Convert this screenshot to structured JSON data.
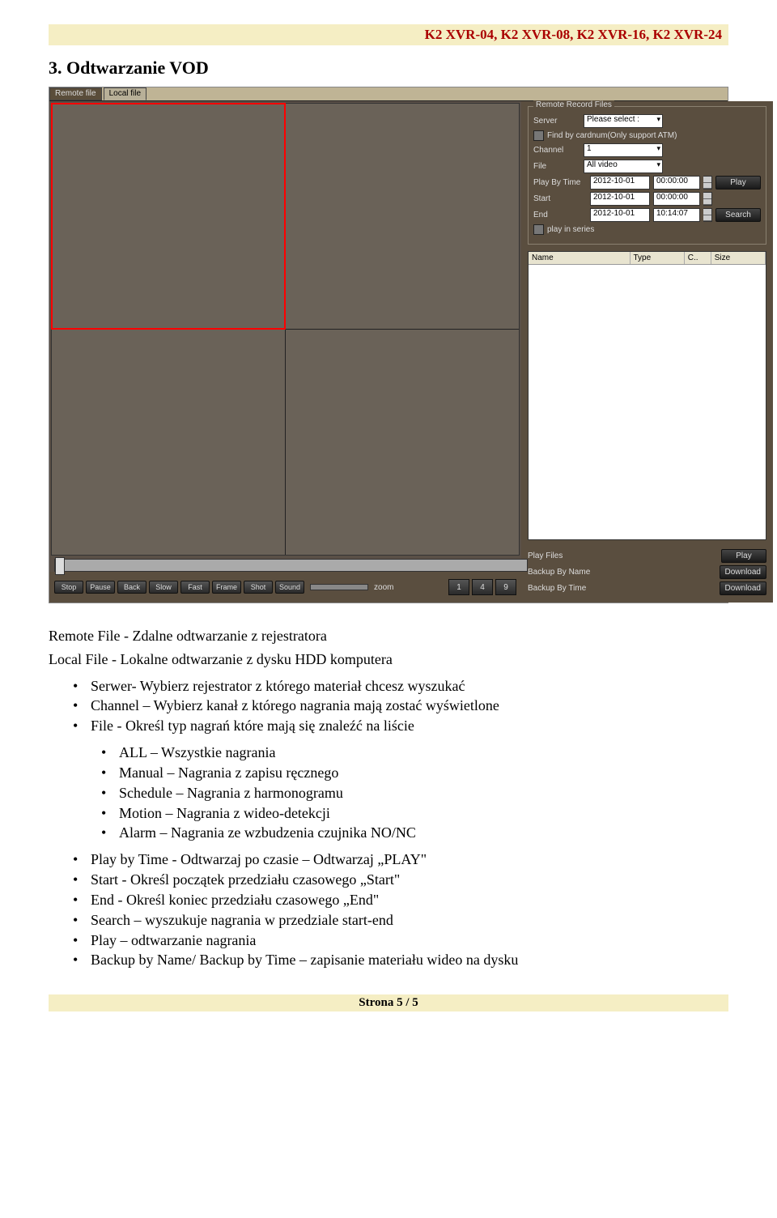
{
  "header": "K2 XVR-04, K2 XVR-08, K2 XVR-16, K2 XVR-24",
  "section_title": "3. Odtwarzanie VOD",
  "app": {
    "tabs": {
      "remote": "Remote file",
      "local": "Local file"
    },
    "remote_panel": {
      "legend": "Remote Record Files",
      "server_label": "Server",
      "server_value": "Please select :",
      "find_by_card": "Find by cardnum(Only support ATM)",
      "channel_label": "Channel",
      "channel_value": "1",
      "file_label": "File",
      "file_value": "All video",
      "play_by_time_label": "Play By Time",
      "start_label": "Start",
      "end_label": "End",
      "date1": "2012-10-01",
      "time_zero": "00:00:00",
      "date2": "2012-10-01",
      "date3": "2012-10-01",
      "time_end": "10:14:07",
      "play_btn": "Play",
      "search_btn": "Search",
      "play_in_series": "play in series"
    },
    "file_columns": {
      "name": "Name",
      "type": "Type",
      "c": "C..",
      "size": "Size"
    },
    "bottom": {
      "play_files": "Play Files",
      "backup_by_name": "Backup By Name",
      "backup_by_time": "Backup By Time",
      "play": "Play",
      "download": "Download"
    },
    "playback": {
      "stop": "Stop",
      "pause": "Pause",
      "back": "Back",
      "slow": "Slow",
      "fast": "Fast",
      "frame": "Frame",
      "shot": "Shot",
      "sound": "Sound",
      "zoom": "zoom",
      "l1": "1",
      "l4": "4",
      "l9": "9"
    }
  },
  "text": {
    "remote_desc": "Remote File - Zdalne odtwarzanie z rejestratora",
    "local_desc": "Local File - Lokalne odtwarzanie z dysku HDD komputera",
    "items": [
      "Serwer- Wybierz rejestrator z którego materiał chcesz wyszukać",
      "Channel – Wybierz kanał z którego nagrania mają zostać wyświetlone",
      "File - Określ typ nagrań które mają się znaleźć na liście"
    ],
    "nested": [
      "ALL – Wszystkie nagrania",
      "Manual – Nagrania z zapisu ręcznego",
      "Schedule – Nagrania z harmonogramu",
      "Motion – Nagrania z wideo-detekcji",
      "Alarm – Nagrania ze wzbudzenia czujnika NO/NC"
    ],
    "items2": [
      "Play by Time - Odtwarzaj po czasie – Odtwarzaj „PLAY\"",
      "Start - Określ początek przedziału czasowego „Start\"",
      "End - Określ koniec przedziału czasowego „End\"",
      "Search – wyszukuje nagrania w przedziale start-end",
      "Play – odtwarzanie nagrania",
      "Backup by Name/ Backup by Time – zapisanie materiału wideo na dysku"
    ]
  },
  "footer": "Strona 5 / 5"
}
